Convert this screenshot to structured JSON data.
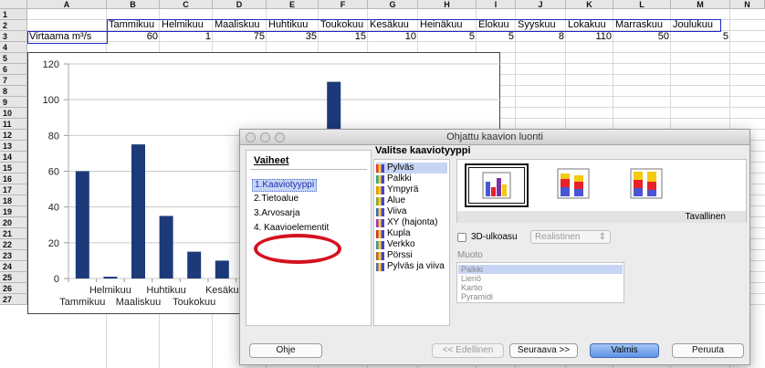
{
  "spreadsheet": {
    "columns": [
      "A",
      "B",
      "C",
      "D",
      "E",
      "F",
      "G",
      "H",
      "I",
      "J",
      "K",
      "L",
      "M",
      "N"
    ],
    "rows": [
      "1",
      "2",
      "3",
      "4",
      "5",
      "6",
      "7",
      "8",
      "9",
      "10",
      "11",
      "12",
      "13",
      "14",
      "15",
      "16",
      "17",
      "18",
      "19",
      "20",
      "21",
      "22",
      "23",
      "24",
      "25",
      "26",
      "27"
    ],
    "row1": [
      "Tammikuu",
      "Helmikuu",
      "Maaliskuu",
      "Huhtikuu",
      "Toukokuu",
      "Kesäkuu",
      "Heinäkuu",
      "Elokuu",
      "Syyskuu",
      "Lokakuu",
      "Marraskuu",
      "Joulukuu"
    ],
    "row2_label": "Virtaama m³/s",
    "row2_values": [
      "60",
      "1",
      "75",
      "35",
      "15",
      "10",
      "5",
      "5",
      "8",
      "110",
      "50",
      "5"
    ]
  },
  "chart_data": {
    "type": "bar",
    "categories": [
      "Tammikuu",
      "Helmikuu",
      "Maaliskuu",
      "Huhtikuu",
      "Toukokuu",
      "Kesäkuu",
      "Heinäkuu",
      "Elokuu",
      "Syyskuu",
      "Lokakuu",
      "Marraskuu",
      "Joulukuu"
    ],
    "values": [
      60,
      1,
      75,
      35,
      15,
      10,
      5,
      5,
      8,
      110,
      50,
      5
    ],
    "ylim": [
      0,
      120
    ],
    "yticks": [
      "0",
      "20",
      "40",
      "60",
      "80",
      "100",
      "120"
    ],
    "xtick_upper": [
      "Helmikuu",
      "Huhtikuu",
      "Kesäku"
    ],
    "xtick_lower": [
      "Tammikuu",
      "Maaliskuu",
      "Toukokuu",
      "Hei"
    ],
    "bar_color": "#1c3a7a",
    "grid": true
  },
  "dialog": {
    "title": "Ohjattu kaavion luonti",
    "steps_header": "Vaiheet",
    "steps": [
      "1.Kaaviotyyppi",
      "2.Tietoalue",
      "3.Arvosarja",
      "4. Kaavioelementit"
    ],
    "chart_type_title": "Valitse kaaviotyyppi",
    "chart_types": [
      {
        "label": "Pylväs",
        "icon": "column-chart-icon"
      },
      {
        "label": "Palkki",
        "icon": "bar-chart-icon"
      },
      {
        "label": "Ympyrä",
        "icon": "pie-chart-icon"
      },
      {
        "label": "Alue",
        "icon": "area-chart-icon"
      },
      {
        "label": "Viiva",
        "icon": "line-chart-icon"
      },
      {
        "label": "XY (hajonta)",
        "icon": "scatter-chart-icon"
      },
      {
        "label": "Kupla",
        "icon": "bubble-chart-icon"
      },
      {
        "label": "Verkko",
        "icon": "net-chart-icon"
      },
      {
        "label": "Pörssi",
        "icon": "stock-chart-icon"
      },
      {
        "label": "Pylväs ja viiva",
        "icon": "column-line-chart-icon"
      }
    ],
    "variant_label": "Tavallinen",
    "three_d_label": "3D-ulkoasu",
    "look_value": "Realistinen",
    "shape_label": "Muoto",
    "shapes": [
      "Palkki",
      "Lieriö",
      "Kartio",
      "Pyramidi"
    ],
    "buttons": {
      "help": "Ohje",
      "back": "<< Edellinen",
      "next": "Seuraava >>",
      "finish": "Valmis",
      "cancel": "Peruuta"
    },
    "colors": {
      "selection": "#c7d5f5",
      "accent_red": "#d4121e",
      "primary": "#5d93e6"
    }
  }
}
